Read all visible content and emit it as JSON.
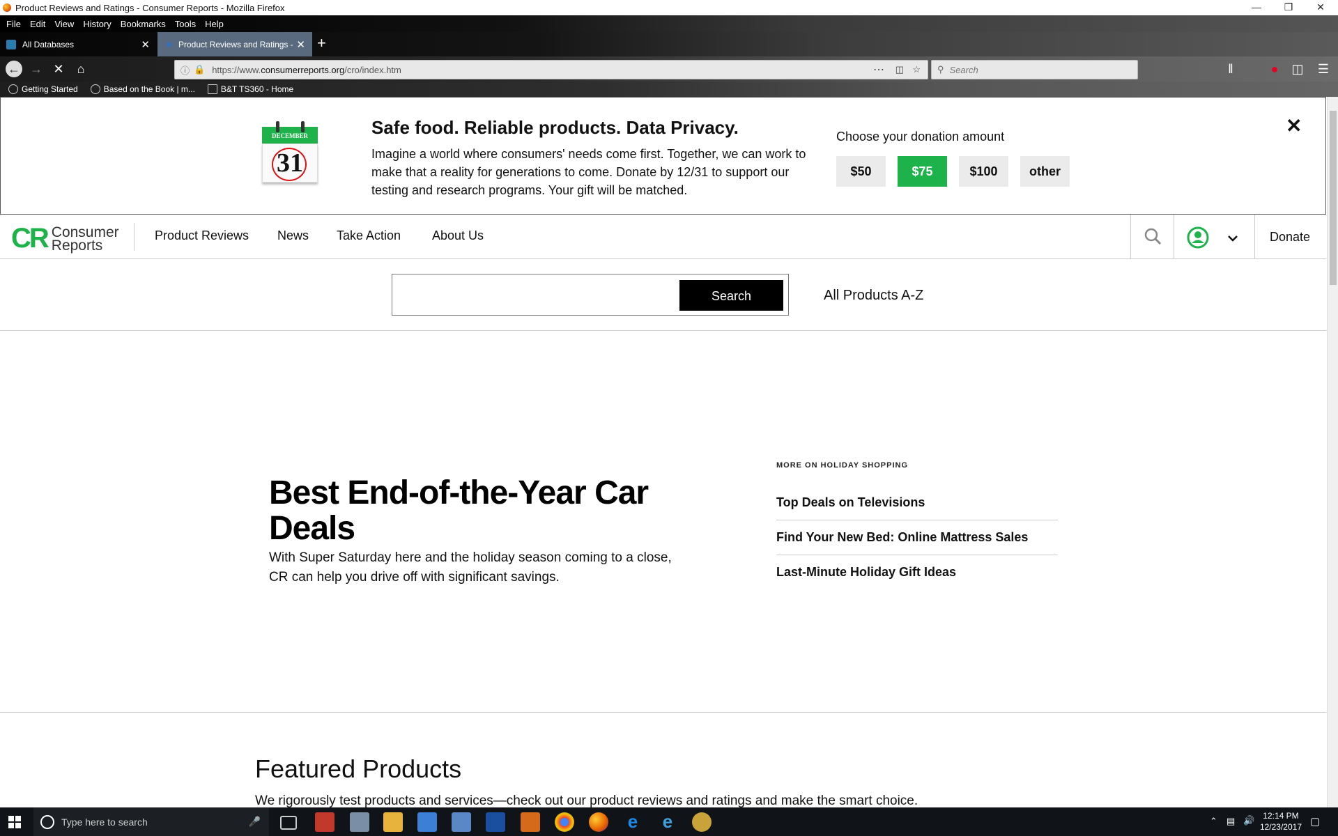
{
  "window": {
    "title": "Product Reviews and Ratings - Consumer Reports - Mozilla Firefox"
  },
  "menu": [
    "File",
    "Edit",
    "View",
    "History",
    "Bookmarks",
    "Tools",
    "Help"
  ],
  "tabs": [
    {
      "label": "All Databases"
    },
    {
      "label": "Product Reviews and Ratings - "
    }
  ],
  "url": {
    "prefix": "https://www.",
    "domain": "consumerreports.org",
    "path": "/cro/index.htm"
  },
  "browser_search": {
    "placeholder": "Search"
  },
  "bookmarks": [
    "Getting Started",
    "Based on the Book | m...",
    "B&T TS360 - Home"
  ],
  "banner": {
    "calendar_month": "DECEMBER",
    "calendar_day": "31",
    "headline": "Safe food. Reliable products. Data Privacy.",
    "body": "Imagine a world where consumers' needs come first. Together, we can work to make that a reality for generations to come. Donate by 12/31 to support our testing and research programs. Your gift will be matched.",
    "choose_label": "Choose your donation amount",
    "amounts": [
      "$50",
      "$75",
      "$100",
      "other"
    ],
    "selected_amount": "$75",
    "close": "✕"
  },
  "site_nav": {
    "logo_letters": "CR",
    "logo_line1": "Consumer",
    "logo_line2": "Reports",
    "links": [
      "Product Reviews",
      "News",
      "Take Action",
      "About Us"
    ],
    "donate": "Donate"
  },
  "site_search": {
    "button": "Search",
    "all_products": "All Products A-Z"
  },
  "hero": {
    "title": "Best End-of-the-Year Car Deals",
    "description": "With Super Saturday here and the holiday season coming to a close, CR can help you drive off with significant savings."
  },
  "more": {
    "heading": "MORE ON HOLIDAY SHOPPING",
    "links": [
      "Top Deals on Televisions",
      "Find Your New Bed: Online Mattress Sales",
      "Last-Minute Holiday Gift Ideas"
    ]
  },
  "featured": {
    "title": "Featured Products",
    "description": "We rigorously test products and services—check out our product reviews and ratings and make the smart choice."
  },
  "taskbar": {
    "search_placeholder": "Type here to search",
    "time": "12:14 PM",
    "date": "12/23/2017"
  },
  "colors": {
    "brand_green": "#1db34a",
    "banner_button": "#ebebeb",
    "black_button": "#000000"
  }
}
